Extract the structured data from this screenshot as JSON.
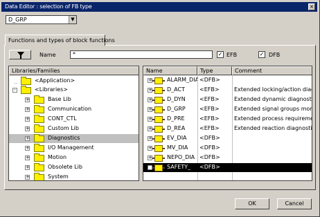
{
  "window": {
    "title": "Data Editor : selection of FB type"
  },
  "library_combo": {
    "value": "D_GRP"
  },
  "tab": {
    "label": "Functions and types of block functions"
  },
  "filter": {
    "name_label": "Name",
    "name_value": "*",
    "efb_label": "EFB",
    "efb_checked": "✓",
    "dfb_label": "DFB",
    "dfb_checked": "✓"
  },
  "tree": {
    "header": "Libraries/Families",
    "items": [
      {
        "label": "<Application>"
      },
      {
        "label": "<Libraries>"
      },
      {
        "label": "Base Lib"
      },
      {
        "label": "Communication"
      },
      {
        "label": "CONT_CTL"
      },
      {
        "label": "Custom Lib"
      },
      {
        "label": "Diagnostics"
      },
      {
        "label": "I/O Management"
      },
      {
        "label": "Motion"
      },
      {
        "label": "Obsolete Lib"
      },
      {
        "label": "System"
      }
    ]
  },
  "table": {
    "columns": [
      "Name",
      "Type",
      "Comment"
    ],
    "rows": [
      {
        "name": "ALARM_DIA",
        "type": "<DFB>",
        "comment": ""
      },
      {
        "name": "D_ACT",
        "type": "<EFB>",
        "comment": "Extended locking/action diagn"
      },
      {
        "name": "D_DYN",
        "type": "<EFB>",
        "comment": "Extended dynamic diagnostics"
      },
      {
        "name": "D_GRP",
        "type": "<EFB>",
        "comment": "Extended signal groups monito"
      },
      {
        "name": "D_PRE",
        "type": "<EFB>",
        "comment": "Extended process requirement"
      },
      {
        "name": "D_REA",
        "type": "<EFB>",
        "comment": "Extended reaction diagnostics"
      },
      {
        "name": "EV_DIA",
        "type": "<DFB>",
        "comment": ""
      },
      {
        "name": "MV_DIA",
        "type": "<DFB>",
        "comment": ""
      },
      {
        "name": "NEPO_DIA",
        "type": "<DFB>",
        "comment": ""
      },
      {
        "name": "SAFETY_",
        "type": "<DFB>",
        "comment": ""
      }
    ]
  },
  "buttons": {
    "ok": "OK",
    "cancel": "Cancel"
  }
}
